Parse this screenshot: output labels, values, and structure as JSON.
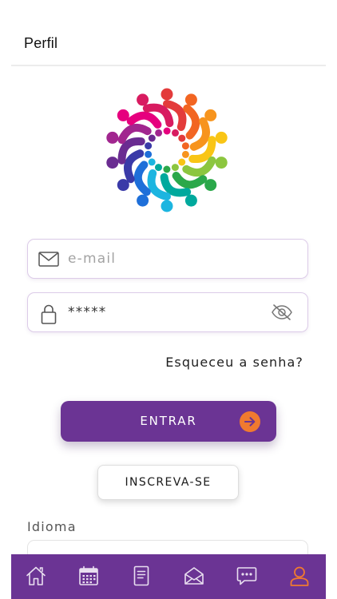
{
  "header": {
    "title": "Perfil"
  },
  "login": {
    "email_placeholder": "e-mail",
    "password_value": "*****",
    "forgot_password": "Esqueceu a senha?",
    "enter_label": "ENTRAR",
    "signup_label": "INSCREVA-SE"
  },
  "language": {
    "label": "Idioma"
  },
  "icons": {
    "email": "envelope-icon",
    "password": "lock-icon",
    "visibility": "eye-slash-icon",
    "enter_arrow": "arrow-right-circle-icon"
  },
  "tabbar": {
    "items": [
      {
        "icon": "home-icon",
        "active": false
      },
      {
        "icon": "calendar-icon",
        "active": false
      },
      {
        "icon": "document-icon",
        "active": false
      },
      {
        "icon": "mail-open-icon",
        "active": false
      },
      {
        "icon": "chat-icon",
        "active": false
      },
      {
        "icon": "user-icon",
        "active": true
      }
    ]
  },
  "colors": {
    "brand_purple": "#6b3494",
    "accent_orange": "#f07a2f",
    "field_border": "#dccbe8",
    "tab_icon": "#e9dff0"
  }
}
